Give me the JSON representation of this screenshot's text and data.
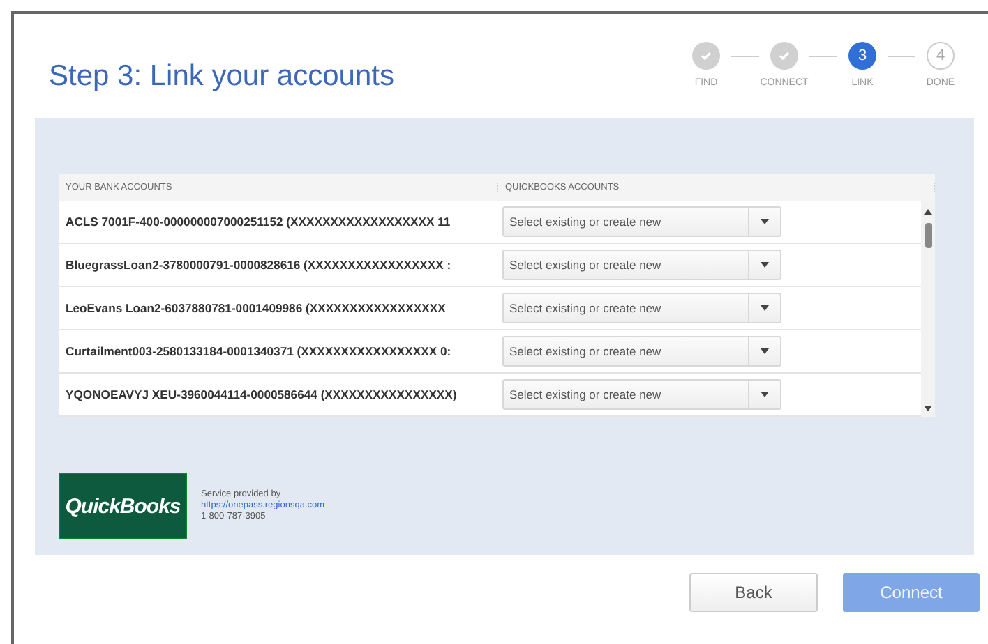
{
  "title": "Step 3: Link your accounts",
  "steps": [
    {
      "label": "FIND",
      "completed": true,
      "selected": false
    },
    {
      "label": "CONNECT",
      "completed": true,
      "selected": false
    },
    {
      "label": "LINK",
      "completed": false,
      "selected": true,
      "number": "3"
    },
    {
      "label": "DONE",
      "completed": false,
      "selected": false,
      "number": "4"
    }
  ],
  "table": {
    "columns": [
      "YOUR BANK ACCOUNTS",
      "QUICKBOOKS ACCOUNTS"
    ],
    "rows": [
      {
        "account": "ACLS 7001F-400-000000007000251152 (XXXXXXXXXXXXXXXXXX 11",
        "select": {
          "placeholder": "Select existing or create new"
        }
      },
      {
        "account": "BluegrassLoan2-3780000791-0000828616 (XXXXXXXXXXXXXXXXX :",
        "select": {
          "placeholder": "Select existing or create new"
        }
      },
      {
        "account": "LeoEvans Loan2-6037880781-0001409986 (XXXXXXXXXXXXXXXXX",
        "select": {
          "placeholder": "Select existing or create new"
        }
      },
      {
        "account": "Curtailment003-2580133184-0001340371 (XXXXXXXXXXXXXXXXX 0:",
        "select": {
          "placeholder": "Select existing or create new"
        }
      },
      {
        "account": "YQONOEAVYJ XEU-3960044114-0000586644 (XXXXXXXXXXXXXXXX)",
        "select": {
          "placeholder": "Select existing or create new"
        }
      }
    ]
  },
  "logo": {
    "text": "QuickBooks"
  },
  "provider": {
    "label": "Service provided by",
    "link": "https://onepass.regionsqa.com",
    "phone": "1-800-787-3905"
  },
  "buttons": [
    {
      "label": "Back",
      "disabled": false
    },
    {
      "label": "Connect",
      "disabled": true
    }
  ]
}
